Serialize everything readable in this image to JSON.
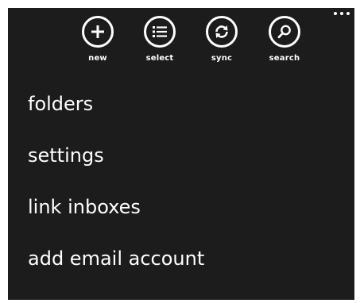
{
  "appbar": {
    "more_icon": "ellipsis-icon",
    "buttons": [
      {
        "label": "new",
        "icon": "plus-icon"
      },
      {
        "label": "select",
        "icon": "checklist-icon"
      },
      {
        "label": "sync",
        "icon": "sync-icon"
      },
      {
        "label": "search",
        "icon": "search-icon"
      }
    ]
  },
  "menu": {
    "items": [
      {
        "label": "folders"
      },
      {
        "label": "settings"
      },
      {
        "label": "link inboxes"
      },
      {
        "label": "add email account"
      }
    ]
  },
  "colors": {
    "background": "#1c1c1c",
    "foreground": "#ffffff",
    "page": "#ffffff"
  }
}
